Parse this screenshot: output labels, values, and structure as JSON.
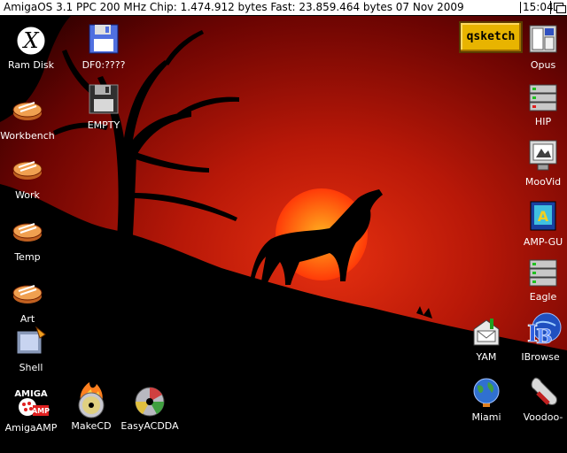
{
  "titlebar": {
    "text": "AmigaOS 3.1 PPC 200 MHz Chip: 1.474.912 bytes Fast: 23.859.464 bytes  07 Nov 2009",
    "clock": "15:04"
  },
  "qsketch": {
    "label": "qsketch"
  },
  "icons_left": [
    {
      "label": "Ram Disk",
      "icon": "ram-disk-icon"
    },
    {
      "label": "Workbench",
      "icon": "drawer-disk-icon"
    },
    {
      "label": "Work",
      "icon": "drawer-disk-icon"
    },
    {
      "label": "Temp",
      "icon": "drawer-disk-icon"
    },
    {
      "label": "Art",
      "icon": "drawer-disk-icon"
    },
    {
      "label": "Shell",
      "icon": "shell-icon"
    }
  ],
  "icons_mid": [
    {
      "label": "DF0:????",
      "icon": "floppy-icon"
    },
    {
      "label": "EMPTY",
      "icon": "floppy-dark-icon"
    }
  ],
  "icons_bottom": [
    {
      "label": "AmigaAMP",
      "icon": "amigaamp-icon"
    },
    {
      "label": "MakeCD",
      "icon": "cd-fire-icon"
    },
    {
      "label": "EasyACDDA",
      "icon": "cd-icon"
    }
  ],
  "icons_right": [
    {
      "label": "Opus",
      "icon": "opus-icon"
    },
    {
      "label": "HIP",
      "icon": "server-icon"
    },
    {
      "label": "MooVid",
      "icon": "monitor-icon"
    },
    {
      "label": "AMP-GU",
      "icon": "amp-gui-icon"
    },
    {
      "label": "Eagle",
      "icon": "server-icon"
    },
    {
      "label": "IBrowse",
      "icon": "ibrowse-icon"
    },
    {
      "label": "Voodoo-",
      "icon": "wrench-icon"
    }
  ],
  "icons_right2": [
    {
      "label": "YAM",
      "icon": "mailbox-icon"
    },
    {
      "label": "Miami",
      "icon": "globe-icon"
    }
  ]
}
